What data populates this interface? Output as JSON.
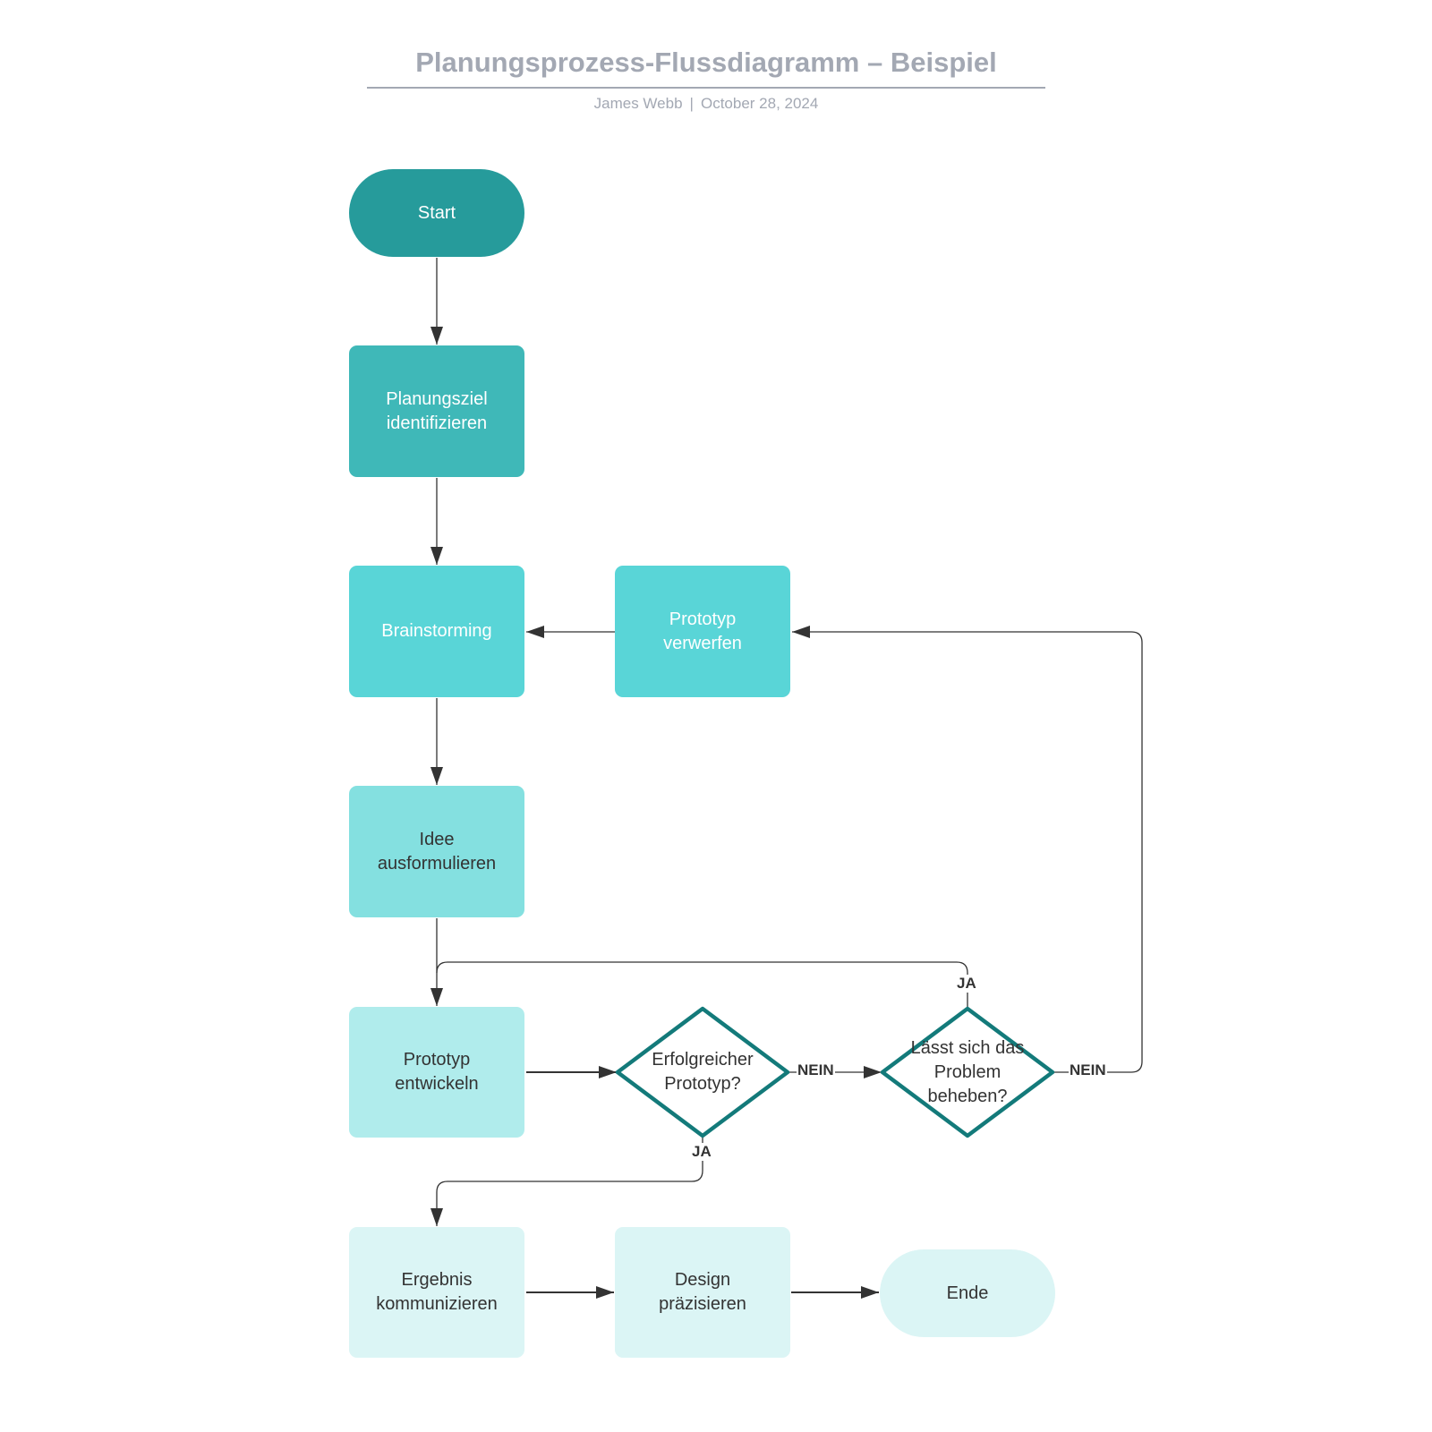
{
  "header": {
    "title": "Planungsprozess-Flussdiagramm – Beispiel",
    "author": "James Webb",
    "separator": "|",
    "date": "October 28, 2024"
  },
  "colors": {
    "start": "#269b9b",
    "step1": "#3fb8b8",
    "step2": "#59d5d7",
    "step3": "#84e0e0",
    "step4": "#b0ecec",
    "step5": "#dbf5f5",
    "decision_stroke": "#137a7a",
    "connector": "#333333",
    "title": "#a3a8b3"
  },
  "nodes": {
    "start": "Start",
    "planungsziel": "Planungsziel identifizieren",
    "brainstorming": "Brainstorming",
    "prototyp_verwerfen": "Prototyp verwerfen",
    "idee": "Idee ausformulieren",
    "prototyp_entwickeln": "Prototyp entwickeln",
    "erfolgreicher": "Erfolgreicher Prototyp?",
    "problem": "Lässt sich das Problem beheben?",
    "ergebnis": "Ergebnis kommunizieren",
    "design": "Design präzisieren",
    "ende": "Ende"
  },
  "edge_labels": {
    "erfolgreicher_nein": "NEIN",
    "erfolgreicher_ja": "JA",
    "problem_ja": "JA",
    "problem_nein": "NEIN"
  }
}
